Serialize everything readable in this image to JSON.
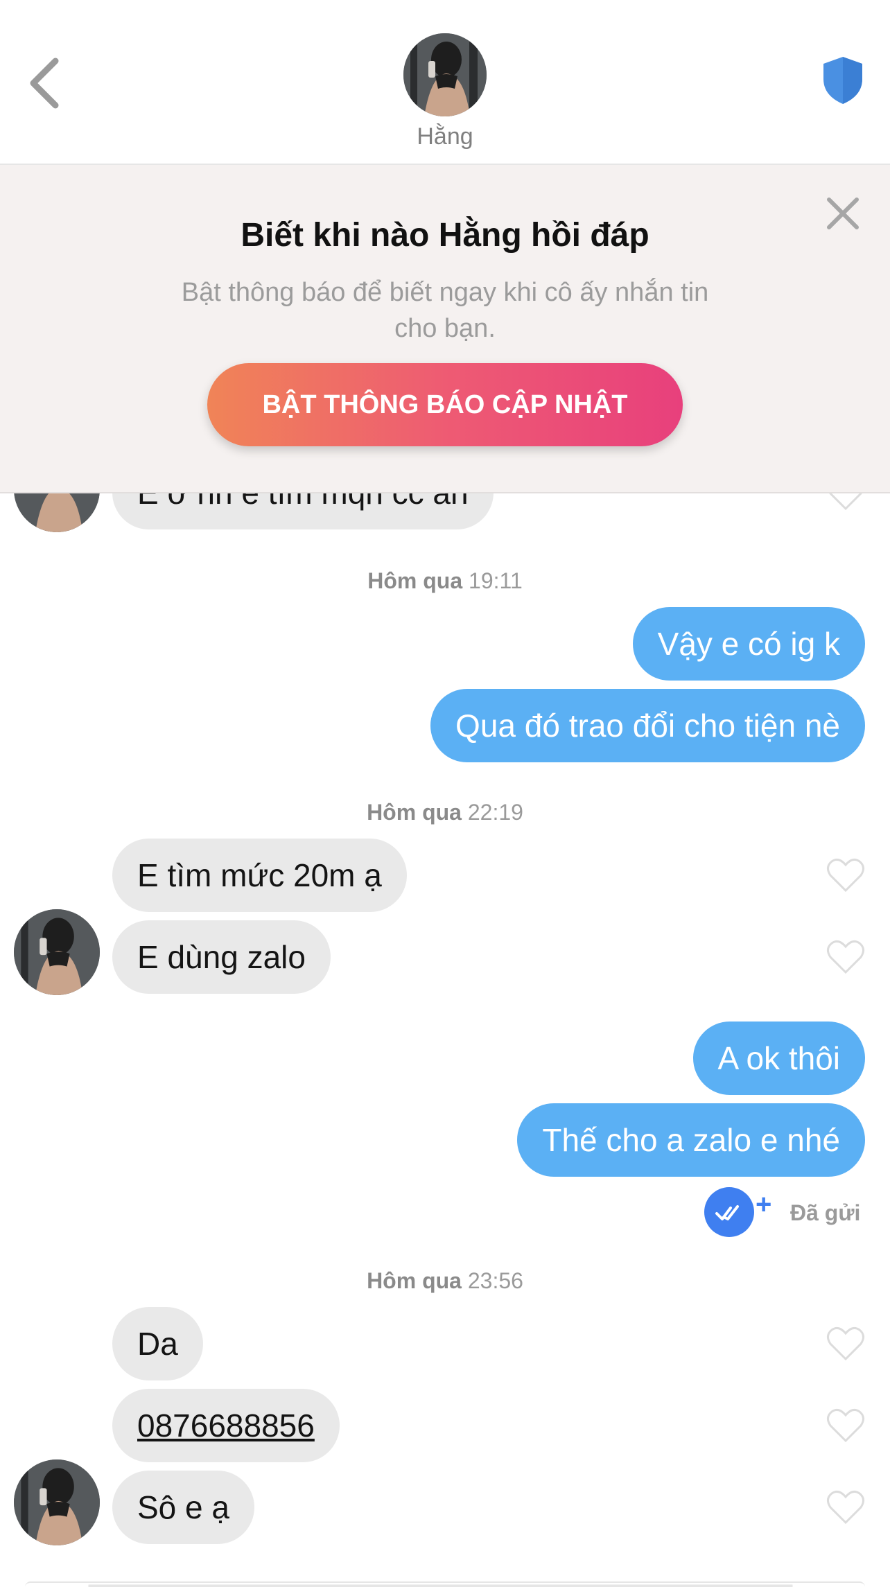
{
  "header": {
    "contact_name": "Hằng",
    "icons": {
      "back": "chevron-left-icon",
      "safety": "shield-icon"
    },
    "accent": "#4a90e2"
  },
  "banner": {
    "title": "Biết khi nào Hằng hồi đáp",
    "text": "Bật thông báo để biết ngay khi cô ấy nhắn tin cho bạn.",
    "button_label": "BẬT THÔNG BÁO CẬP NHẬT",
    "close_icon": "close-icon"
  },
  "messages": {
    "partial_in": "E ở hn e tìm mqh cc ăn",
    "group1": {
      "ts_day": "Hôm qua",
      "ts_time": "19:11",
      "out": [
        "Vậy e có ig k",
        "Qua đó trao đổi cho tiện nè"
      ]
    },
    "group2": {
      "ts_day": "Hôm qua",
      "ts_time": "22:19",
      "in": [
        "E tìm mức 20m ạ",
        "E dùng zalo"
      ],
      "out": [
        "A ok thôi",
        "Thế cho a zalo e nhé"
      ]
    },
    "status": "Đã gửi",
    "group3": {
      "ts_day": "Hôm qua",
      "ts_time": "23:56",
      "in": [
        "Da",
        "0876688856",
        "Sô e ạ"
      ]
    }
  },
  "colors": {
    "out_bubble": "#5bb0f4",
    "in_bubble": "#e9e9e9",
    "banner_bg": "#f5f1f0"
  }
}
